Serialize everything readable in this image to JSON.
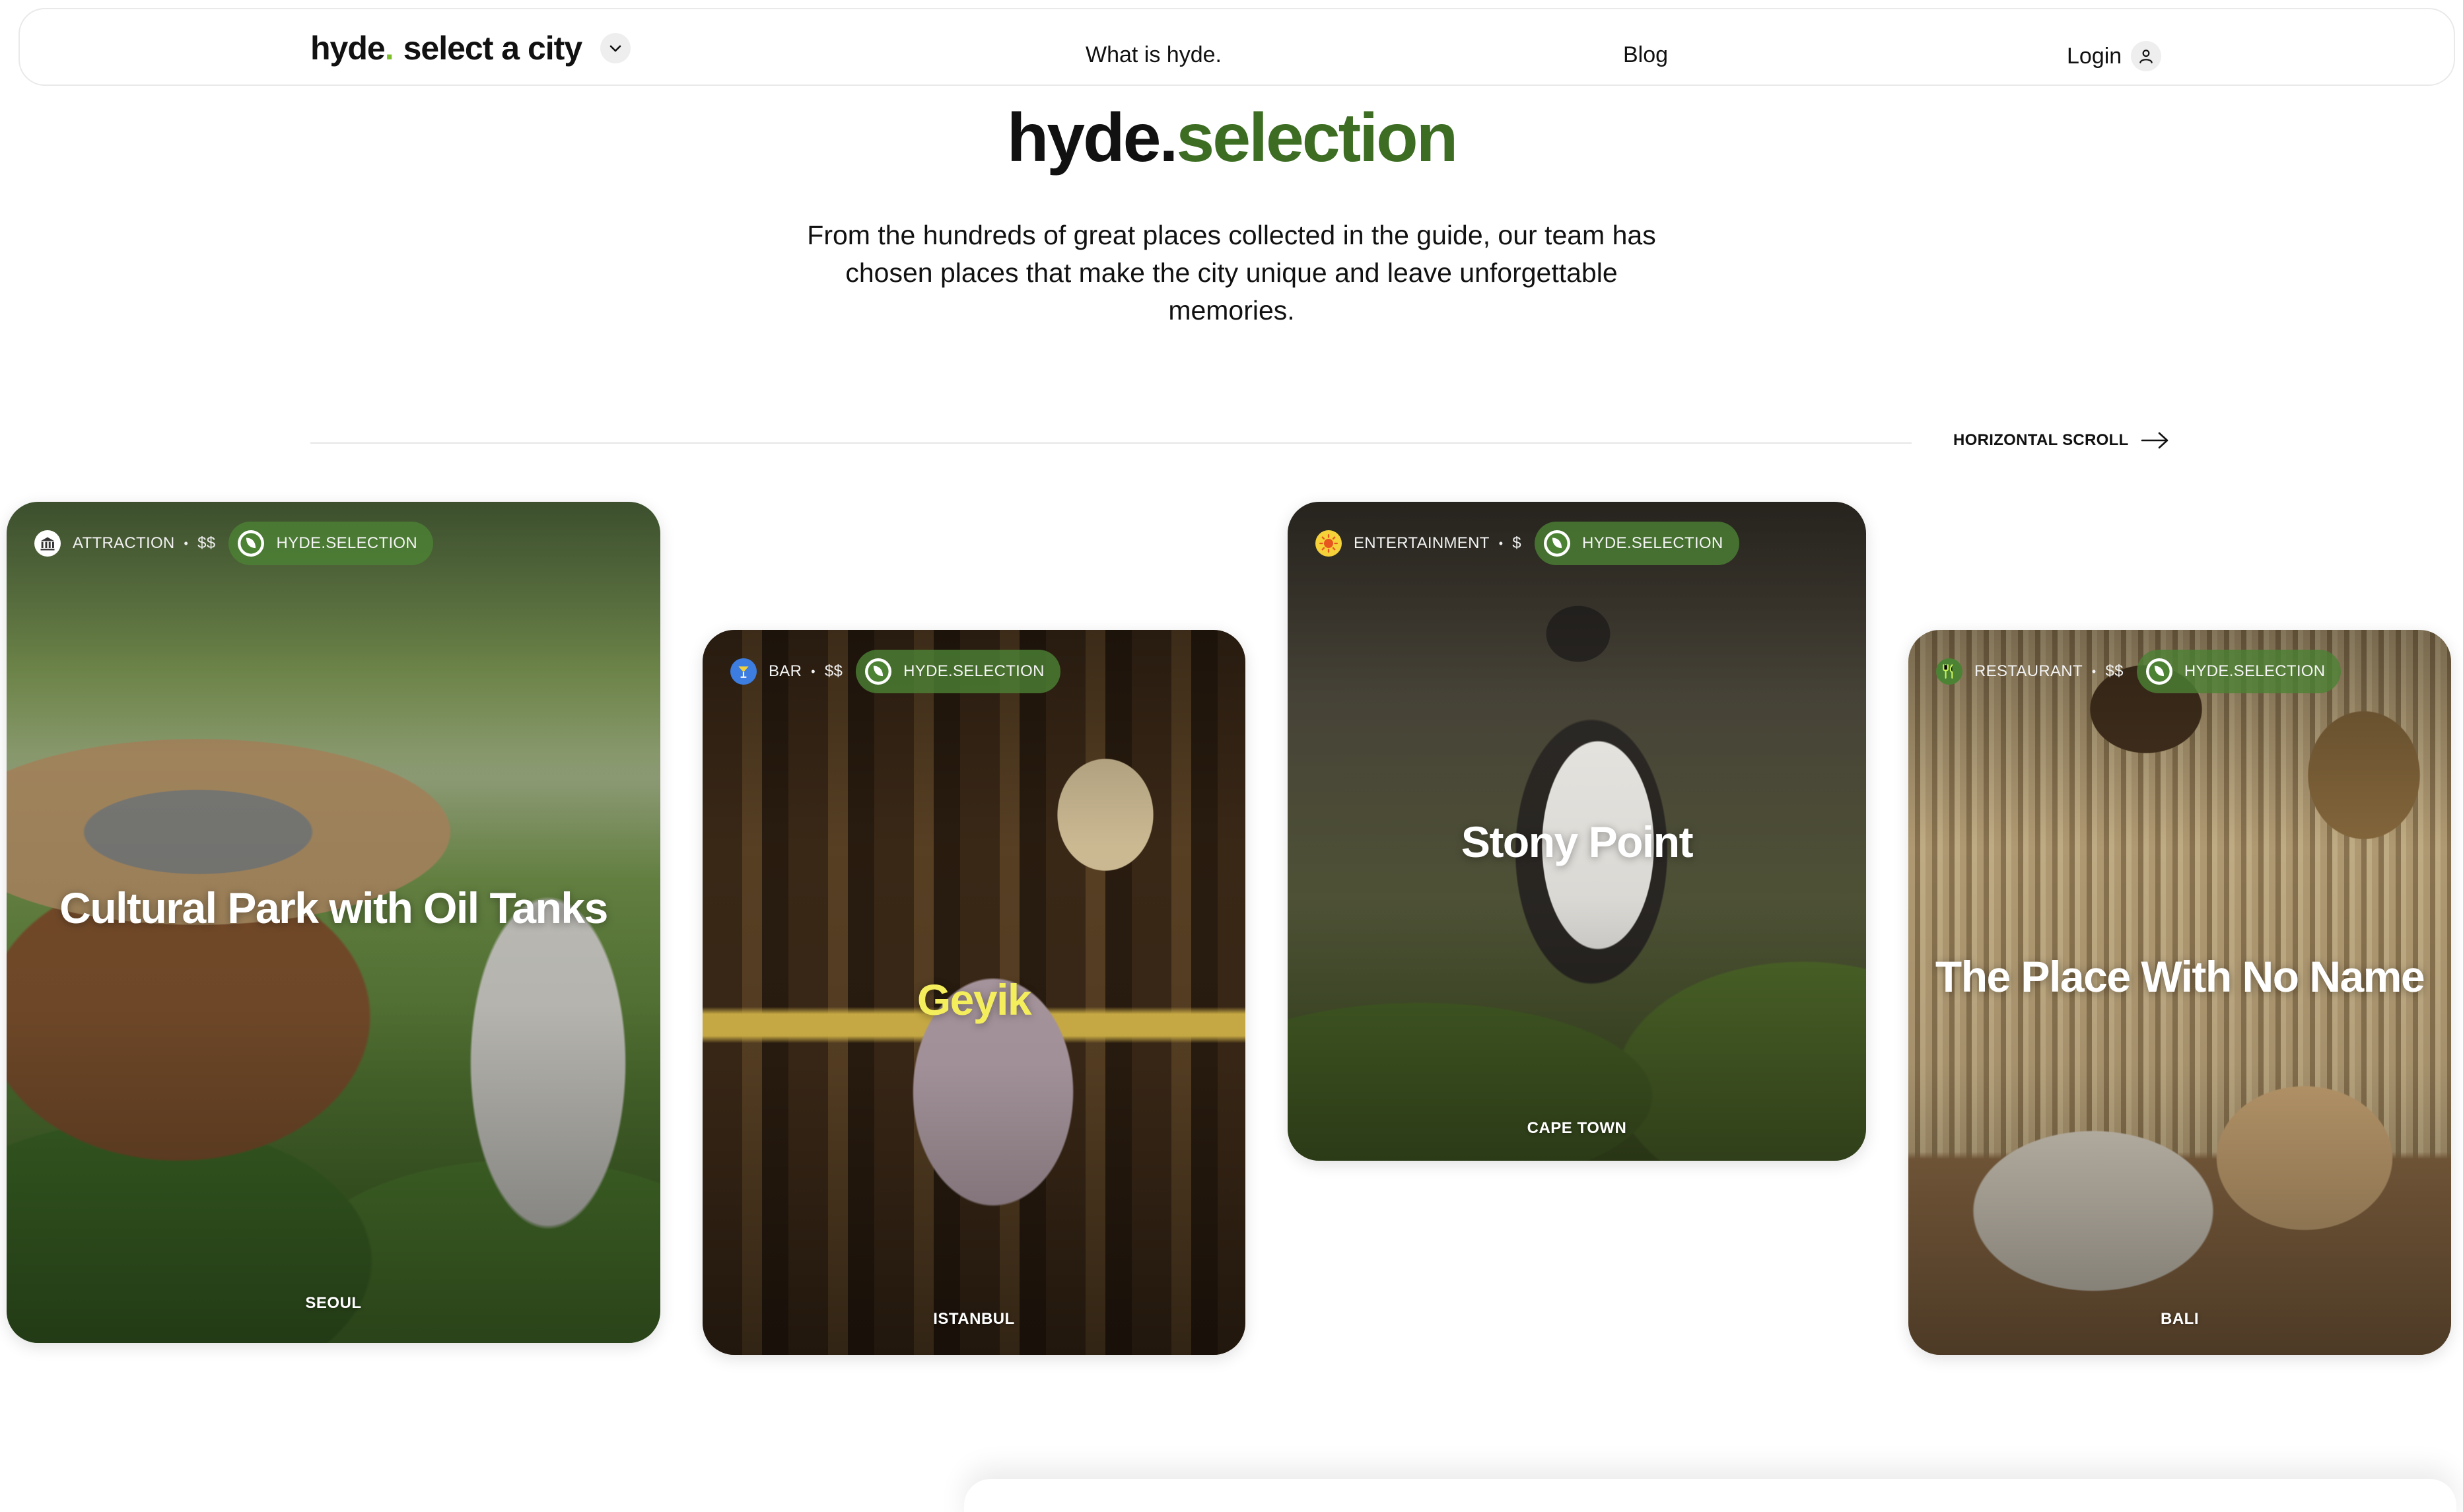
{
  "nav": {
    "brand": "hyde",
    "brand_dot": ".",
    "city_select": "select a city",
    "what_is": "What is hyde.",
    "blog": "Blog",
    "login": "Login",
    "icons": {
      "city_chevron": "chevron-down-icon",
      "login": "user-icon"
    }
  },
  "hero": {
    "title_part1": "hyde.",
    "title_part2": "selection",
    "description": "From the hundreds of great places collected in the guide, our team has chosen places that make the city unique and leave unforgettable memories."
  },
  "scroll_hint": {
    "label": "HORIZONTAL SCROLL",
    "icon": "arrow-right-icon"
  },
  "cards": [
    {
      "category": "ATTRACTION",
      "price": "$$",
      "badge": "HYDE.SELECTION",
      "title": "Cultural Park with Oil Tanks",
      "city": "SEOUL",
      "category_icon": "museum-icon",
      "title_color": "#ffffff"
    },
    {
      "category": "BAR",
      "price": "$$",
      "badge": "HYDE.SELECTION",
      "title": "Geyik",
      "city": "ISTANBUL",
      "category_icon": "cocktail-icon",
      "title_color": "#f4ee5c"
    },
    {
      "category": "ENTERTAINMENT",
      "price": "$",
      "badge": "HYDE.SELECTION",
      "title": "Stony Point",
      "city": "CAPE TOWN",
      "category_icon": "sun-icon",
      "title_color": "#ffffff"
    },
    {
      "category": "RESTAURANT",
      "price": "$$",
      "badge": "HYDE.SELECTION",
      "title": "The Place With No Name",
      "city": "BALI",
      "category_icon": "fork-knife-icon",
      "title_color": "#ffffff"
    }
  ],
  "colors": {
    "brand_green": "#3c6d22",
    "badge_green": "#4c8234",
    "brand_dot": "#7cbf2a"
  }
}
